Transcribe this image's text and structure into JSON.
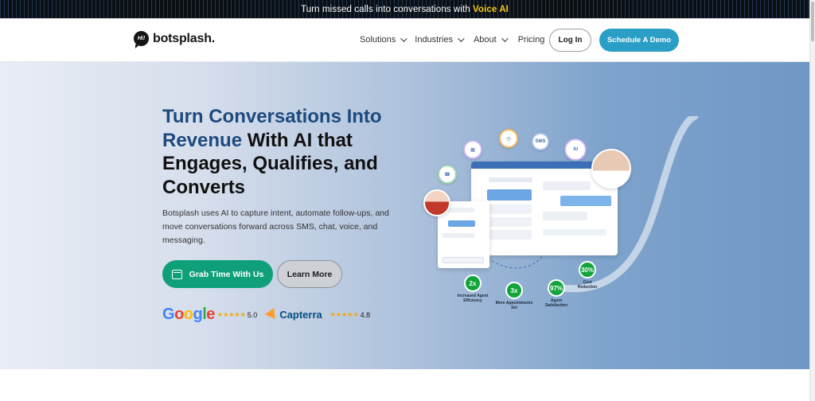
{
  "announcement": {
    "text": "Turn missed calls into conversations with ",
    "highlight": "Voice AI"
  },
  "header": {
    "logo_badge": "Hi!",
    "logo_text": "botsplash.",
    "nav": {
      "solutions": "Solutions",
      "industries": "Industries",
      "about": "About",
      "pricing": "Pricing"
    },
    "login": "Log In",
    "demo": "Schedule A Demo"
  },
  "hero": {
    "headline_blue": "Turn Conversations Into Revenue",
    "headline_rest": " With AI that Engages, Qualifies, and Converts",
    "subtext": "Botsplash uses AI to capture intent, automate follow-ups, and move conversations forward across SMS, chat, voice, and messaging.",
    "cta_primary": "Grab Time With Us",
    "cta_secondary": "Learn More",
    "ratings": {
      "google": "Google",
      "google_score": "5.0",
      "capterra": "Capterra",
      "capterra_score": "4.8",
      "stars": "★★★★★"
    }
  },
  "illustration": {
    "chips": {
      "ai": "AI",
      "sms": "SMS"
    },
    "stats": [
      {
        "value": "30%",
        "label": "Cost Reduction"
      },
      {
        "value": "2x",
        "label": "Increased Agent Efficiency"
      },
      {
        "value": "3x",
        "label": "More Appointments Set"
      },
      {
        "value": "97%",
        "label": "Agent Satisfaction"
      }
    ]
  },
  "colors": {
    "accent": "#2a9ec7",
    "primary_cta": "#0fa07a",
    "headline_blue": "#1d4a7e",
    "highlight": "#f5c518",
    "stat_green": "#12a33b"
  }
}
